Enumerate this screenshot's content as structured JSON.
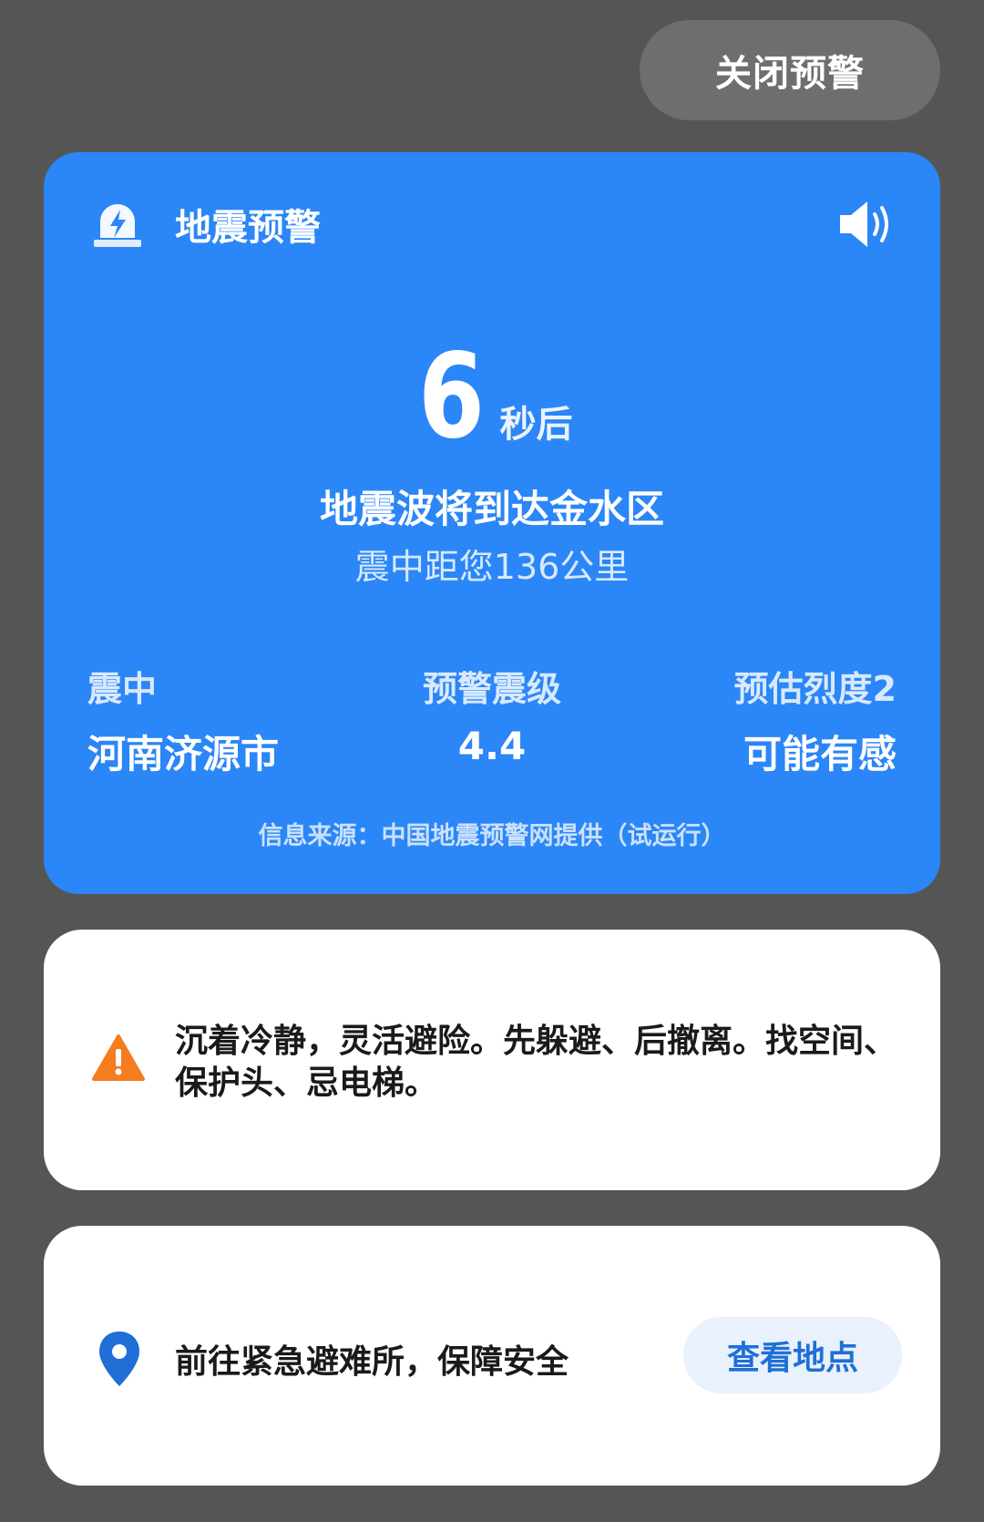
{
  "top": {
    "close_label": "关闭预警"
  },
  "alert": {
    "title": "地震预警",
    "countdown_value": "6",
    "countdown_unit": "秒后",
    "arrival_text": "地震波将到达金水区",
    "distance_text": "震中距您136公里",
    "epicenter_label": "震中",
    "epicenter_value": "河南济源市",
    "magnitude_label": "预警震级",
    "magnitude_value": "4.4",
    "intensity_label": "预估烈度2",
    "intensity_value": "可能有感",
    "source": "信息来源：中国地震预警网提供（试运行）",
    "bg_color": "#2b86f7"
  },
  "tip": {
    "text": "沉着冷静，灵活避险。先躲避、后撤离。找空间、保护头、忌电梯。",
    "icon": "warning-icon",
    "icon_color": "#f57c1f"
  },
  "shelter": {
    "text": "前往紧急避难所，保障安全",
    "button_label": "查看地点",
    "icon": "location-pin-icon",
    "icon_color": "#1f6fd6"
  }
}
